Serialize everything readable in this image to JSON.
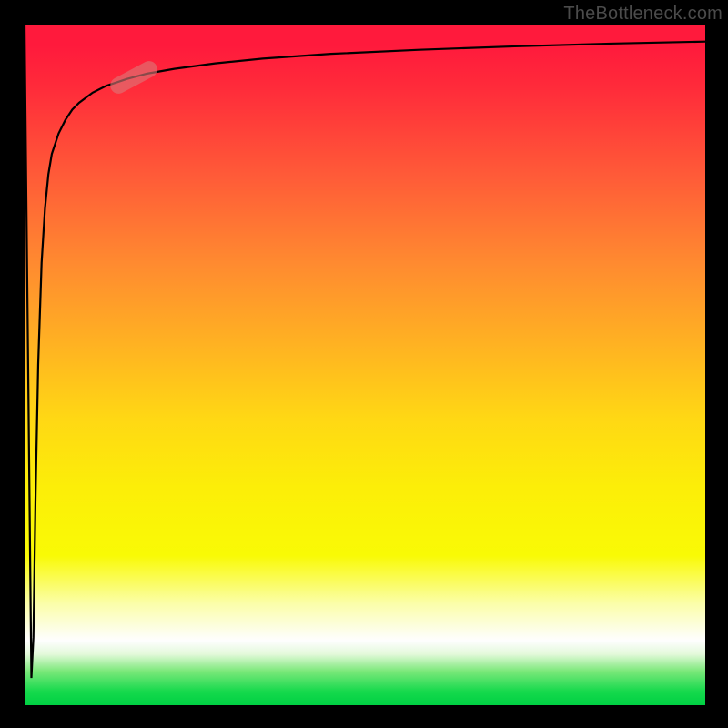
{
  "watermark": "TheBottleneck.com",
  "colors": {
    "frame_bg": "#000000",
    "watermark_text": "#4b4b4b",
    "curve_stroke": "#000000",
    "pill_fill": "rgba(220,120,120,0.62)",
    "gradient_stops": [
      "#ff1a3c",
      "#ff5a38",
      "#ffb222",
      "#fcee08",
      "#fefefe",
      "#7be87a",
      "#00d043"
    ]
  },
  "chart_data": {
    "type": "line",
    "title": "",
    "xlabel": "",
    "ylabel": "",
    "xlim": [
      0,
      100
    ],
    "ylim": [
      0,
      100
    ],
    "grid": false,
    "legend": false,
    "series": [
      {
        "name": "curve",
        "x": [
          0,
          1,
          1.3,
          1.6,
          2,
          2.5,
          3,
          3.5,
          4,
          5,
          6,
          7,
          8,
          10,
          12,
          15,
          18,
          22,
          28,
          35,
          45,
          58,
          72,
          86,
          100
        ],
        "y": [
          100,
          4,
          10,
          30,
          50,
          65,
          73,
          78,
          81,
          84,
          86,
          87.5,
          88.5,
          90,
          91,
          92,
          92.8,
          93.5,
          94.3,
          95,
          95.7,
          96.3,
          96.8,
          97.2,
          97.5
        ]
      }
    ],
    "marker": {
      "name": "highlight-pill",
      "x": 16,
      "y": 92.2,
      "angle_deg": -28
    }
  }
}
